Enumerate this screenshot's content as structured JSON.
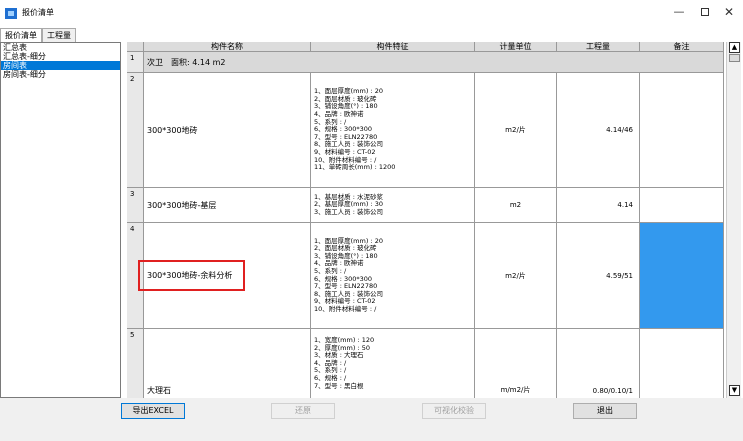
{
  "window": {
    "title": "报价清单",
    "minimize": "—",
    "close": "✕",
    "icon": "app-icon"
  },
  "tabs": [
    {
      "label": "报价清单",
      "active": true
    },
    {
      "label": "工程量",
      "active": false
    }
  ],
  "left_list": {
    "items": [
      {
        "label": "汇总表",
        "selected": false
      },
      {
        "label": "汇总表-细分",
        "selected": false
      },
      {
        "label": "房间表",
        "selected": true
      },
      {
        "label": "房间表-细分",
        "selected": false
      }
    ]
  },
  "table": {
    "headers": [
      "构件名称",
      "构件特征",
      "计量单位",
      "工程量",
      "备注"
    ],
    "group_row": {
      "num": "1",
      "label": "次卫　面积: 4.14 m2"
    },
    "rows": [
      {
        "num": "2",
        "name": "300*300地砖",
        "features": "1、面层厚度(mm) : 20\n2、面层材质 : 玻化砖\n3、铺设角度(°) : 180\n4、品牌 : 欧神诺\n5、系列 : /\n6、规格 : 300*300\n7、型号 : ELN22780\n8、施工人员 : 装饰公司\n9、材料编号 : CT-02\n10、附件材料编号 : /\n11、单砖周长(mm) : 1200",
        "unit": "m2/片",
        "quantity": "4.14/46",
        "remark": ""
      },
      {
        "num": "3",
        "name": "300*300地砖-基层",
        "features": "1、基层材质 : 水泥砂浆\n2、基层厚度(mm) : 30\n3、施工人员 : 装饰公司",
        "unit": "m2",
        "quantity": "4.14",
        "remark": ""
      },
      {
        "num": "4",
        "name": "300*300地砖-余料分析",
        "features": "1、面层厚度(mm) : 20\n2、面层材质 : 玻化砖\n3、铺设角度(°) : 180\n4、品牌 : 欧神诺\n5、系列 : /\n6、规格 : 300*300\n7、型号 : ELN22780\n8、施工人员 : 装饰公司\n9、材料编号 : CT-02\n10、附件材料编号 : /",
        "unit": "m2/片",
        "quantity": "4.59/51",
        "remark": ""
      },
      {
        "num": "5",
        "name": "大理石",
        "features": "1、宽度(mm) : 120\n2、厚度(mm) : 50\n3、材质 : 大理石\n4、品牌 : /\n5、系列 : /\n6、规格 : /\n7、型号 : 黑白根",
        "unit": "m/m2/片",
        "quantity": "0.80/0.10/1",
        "remark": ""
      }
    ]
  },
  "buttons": {
    "export": "导出EXCEL",
    "reset": "还原",
    "visual_check": "可视化校验",
    "exit": "退出"
  },
  "colors": {
    "selected_blue": "#0078d7",
    "highlight_cell": "#3399ee",
    "callout_red": "#e02020"
  }
}
